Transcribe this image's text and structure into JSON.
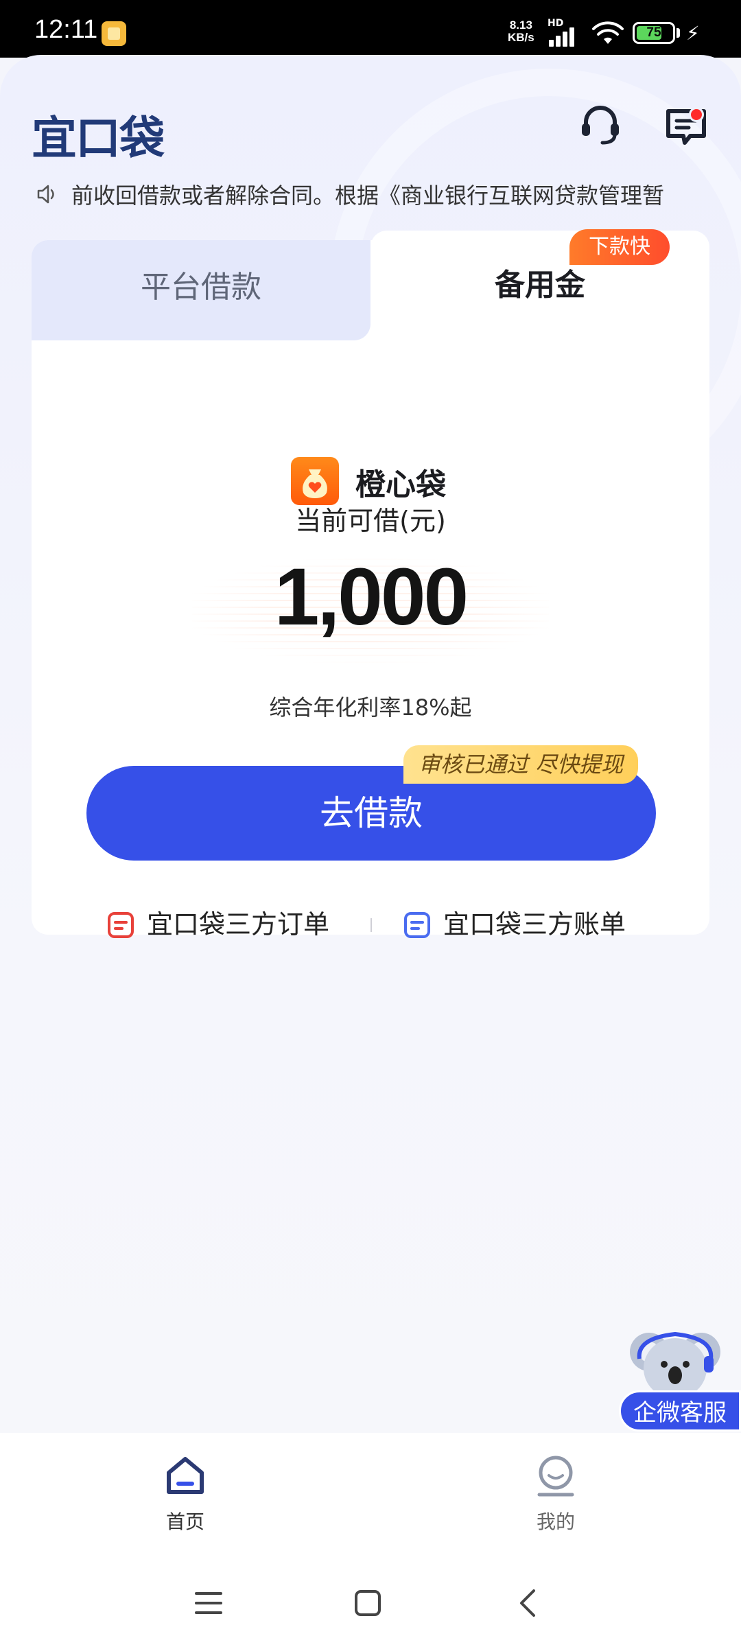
{
  "status_bar": {
    "time": "12:11",
    "network_speed_value": "8.13",
    "network_speed_unit": "KB/s",
    "hd_label": "HD",
    "battery": "75"
  },
  "header": {
    "logo": "宜口袋",
    "icons": [
      "headset-icon",
      "message-icon"
    ]
  },
  "notice": {
    "text": "前收回借款或者解除合同。根据《商业银行互联网贷款管理暂"
  },
  "tabs": {
    "left": "平台借款",
    "right": "备用金",
    "badge": "下款快"
  },
  "product": {
    "name": "橙心袋",
    "amount_label": "当前可借(元)",
    "amount": "1,000",
    "rate": "综合年化利率18%起"
  },
  "cta": {
    "label": "去借款",
    "tag": "审核已通过 尽快提现"
  },
  "links": {
    "orders": "宜口袋三方订单",
    "bills": "宜口袋三方账单"
  },
  "customer_service": {
    "label": "企微客服"
  },
  "bottom_nav": {
    "home": "首页",
    "mine": "我的"
  },
  "colors": {
    "primary": "#3650e8",
    "badge_orange": "#ff5a2c",
    "tag_yellow": "#ffd46a",
    "logo_navy": "#213a78"
  }
}
